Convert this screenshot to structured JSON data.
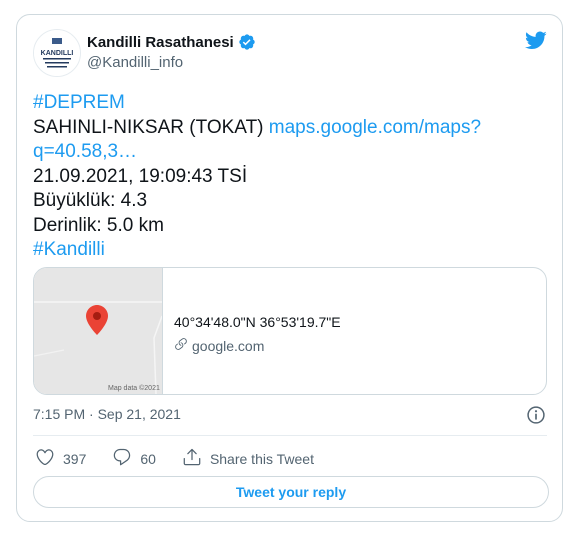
{
  "author": {
    "name": "Kandilli Rasathanesi",
    "handle": "@Kandilli_info",
    "avatar_text": "KANDILLI"
  },
  "tweet": {
    "lines": [
      {
        "parts": [
          {
            "text": "#DEPREM",
            "link": true
          }
        ]
      },
      {
        "parts": [
          {
            "text": "SAHINLI-NIKSAR (TOKAT) ",
            "link": false
          },
          {
            "text": "maps.google.com/maps?",
            "link": true
          }
        ]
      },
      {
        "parts": [
          {
            "text": "q=40.58,3…",
            "link": true
          }
        ]
      },
      {
        "parts": [
          {
            "text": "21.09.2021, 19:09:43 TSİ",
            "link": false
          }
        ]
      },
      {
        "parts": [
          {
            "text": "Büyüklük: 4.3",
            "link": false
          }
        ]
      },
      {
        "parts": [
          {
            "text": "Derinlik: 5.0 km",
            "link": false
          }
        ]
      },
      {
        "parts": [
          {
            "text": "#Kandilli",
            "link": true
          }
        ]
      }
    ]
  },
  "map_card": {
    "coords": "40°34'48.0\"N 36°53'19.7\"E",
    "domain": "google.com",
    "credit": "Map data ©2021"
  },
  "timestamp": "7:15 PM · Sep 21, 2021",
  "actions": {
    "likes": "397",
    "replies": "60",
    "share_label": "Share this Tweet"
  },
  "reply_button": "Tweet your reply",
  "colors": {
    "accent": "#1d9bf0",
    "like_icon": "#536471",
    "map_pin": "#ea4335"
  },
  "icons": [
    "verified-badge-icon",
    "twitter-bird-icon",
    "map-pin-icon",
    "link-icon",
    "info-icon",
    "heart-icon",
    "reply-icon",
    "share-icon"
  ]
}
